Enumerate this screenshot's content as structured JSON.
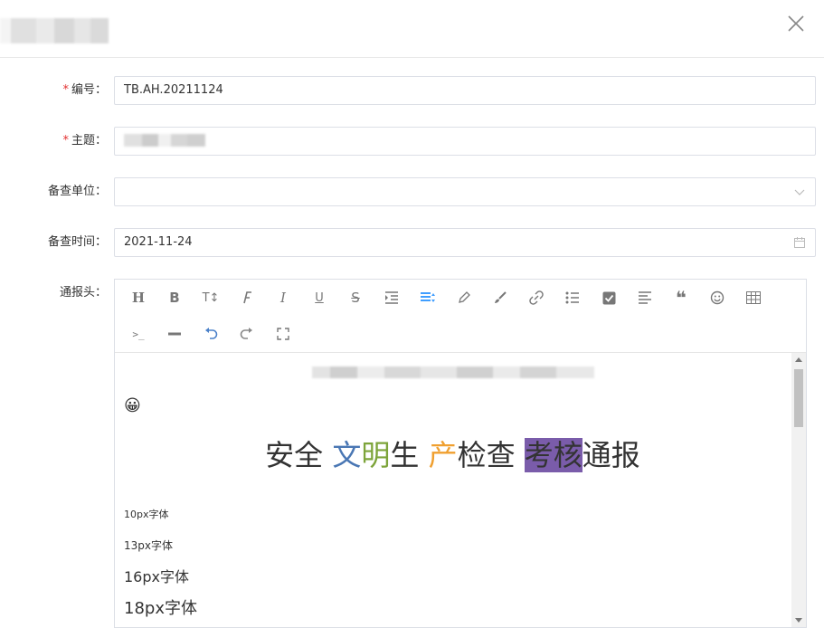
{
  "form": {
    "fields": [
      {
        "label": "编号：",
        "required": true,
        "value": "TB.AH.20211124"
      },
      {
        "label": "主题：",
        "required": true,
        "value": ""
      },
      {
        "label": "备查单位：",
        "required": false,
        "value": ""
      },
      {
        "label": "备查时间：",
        "required": false,
        "value": "2021-11-24"
      },
      {
        "label": "通报头：",
        "required": false
      }
    ],
    "required_mark": "*"
  },
  "editor": {
    "toolbar": [
      "heading",
      "bold",
      "text-size",
      "font-family",
      "italic",
      "underline",
      "strikethrough",
      "indent",
      "line-height",
      "pencil",
      "brush",
      "link",
      "bullet-list",
      "checkbox",
      "align",
      "quote",
      "emoji",
      "table",
      "code",
      "divider",
      "undo",
      "redo",
      "fullscreen"
    ],
    "toolbar_glyphs": {
      "heading": "H",
      "bold": "B",
      "text-size": "T↕",
      "italic": "I",
      "underline": "U",
      "strikethrough": "S"
    },
    "emoji": "😀",
    "title_parts": [
      {
        "text": "安全 ",
        "color": "#333333"
      },
      {
        "text": "文",
        "color": "#4a77b4"
      },
      {
        "text": "明",
        "color": "#7da43a"
      },
      {
        "text": "生 ",
        "color": "#333333"
      },
      {
        "text": "产",
        "color": "#f0a030"
      },
      {
        "text": "检查 ",
        "color": "#333333"
      },
      {
        "text": "考核",
        "color": "#333333",
        "bg": "#7a5caa"
      },
      {
        "text": "通报",
        "color": "#333333"
      }
    ],
    "samples": [
      "10px字体",
      "13px字体",
      "16px字体",
      "18px字体"
    ]
  },
  "colors": {
    "accent": "#409eff",
    "border": "#dcdfe6",
    "required": "#e23030"
  }
}
